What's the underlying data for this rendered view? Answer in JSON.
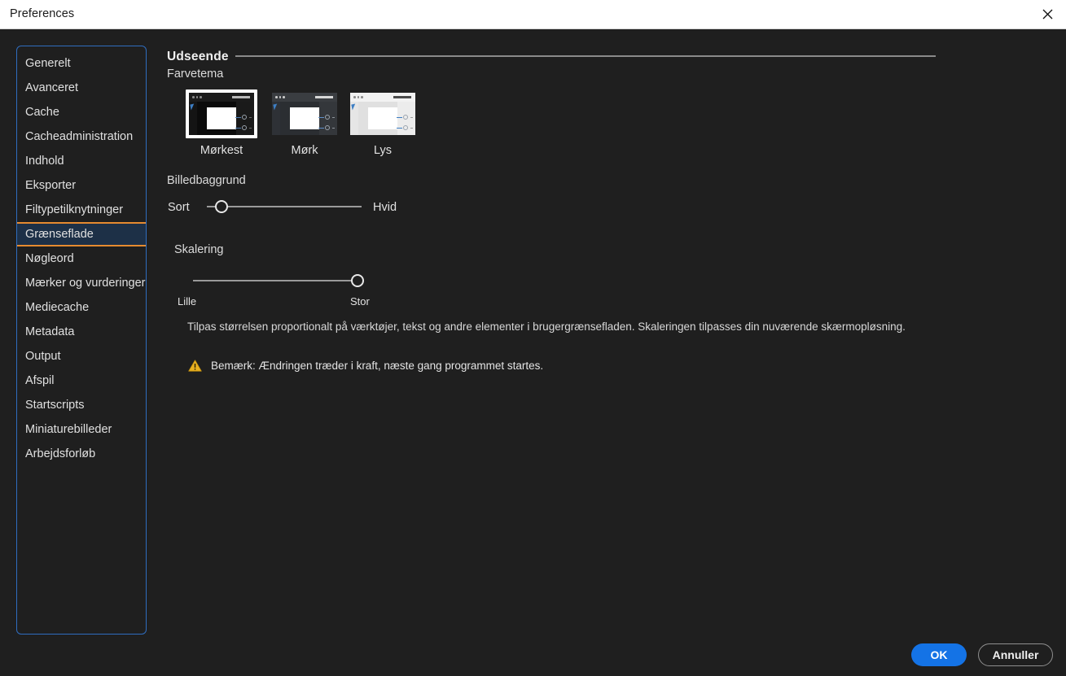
{
  "window": {
    "title": "Preferences",
    "close_icon": "close-icon"
  },
  "sidebar": {
    "items": [
      {
        "label": "Generelt",
        "selected": false
      },
      {
        "label": "Avanceret",
        "selected": false
      },
      {
        "label": "Cache",
        "selected": false
      },
      {
        "label": "Cacheadministration",
        "selected": false
      },
      {
        "label": "Indhold",
        "selected": false
      },
      {
        "label": "Eksporter",
        "selected": false
      },
      {
        "label": "Filtypetilknytninger",
        "selected": false
      },
      {
        "label": "Grænseflade",
        "selected": true
      },
      {
        "label": "Nøgleord",
        "selected": false
      },
      {
        "label": "Mærker og vurderinger",
        "selected": false
      },
      {
        "label": "Mediecache",
        "selected": false
      },
      {
        "label": "Metadata",
        "selected": false
      },
      {
        "label": "Output",
        "selected": false
      },
      {
        "label": "Afspil",
        "selected": false
      },
      {
        "label": "Startscripts",
        "selected": false
      },
      {
        "label": "Miniaturebilleder",
        "selected": false
      },
      {
        "label": "Arbejdsforløb",
        "selected": false
      }
    ]
  },
  "main": {
    "section_heading": "Udseende",
    "colortheme_label": "Farvetema",
    "themes": [
      {
        "label": "Mørkest",
        "selected": true,
        "preview": "darkest"
      },
      {
        "label": "Mørk",
        "selected": false,
        "preview": "dark"
      },
      {
        "label": "Lys",
        "selected": false,
        "preview": "light"
      }
    ],
    "image_background": {
      "label": "Billedbaggrund",
      "min_label": "Sort",
      "max_label": "Hvid",
      "value_percent": 6
    },
    "scaling": {
      "label": "Skalering",
      "min_label": "Lille",
      "max_label": "Stor",
      "value_percent": 100
    },
    "description": "Tilpas størrelsen proportionalt på værktøjer, tekst og andre elementer i brugergrænsefladen. Skaleringen tilpasses din nuværende skærmopløsning.",
    "note": {
      "icon": "warning-triangle-icon",
      "text": "Bemærk: Ændringen træder i kraft, næste gang programmet startes."
    }
  },
  "footer": {
    "ok_label": "OK",
    "cancel_label": "Annuller"
  },
  "colors": {
    "accent_blue": "#1473e6",
    "selection_outline": "#e58a30",
    "selection_fill": "#1d3047",
    "focus_ring": "#2f6dbf",
    "warning": "#e8b020",
    "background": "#1f1f1f",
    "titlebar": "#ffffff"
  }
}
